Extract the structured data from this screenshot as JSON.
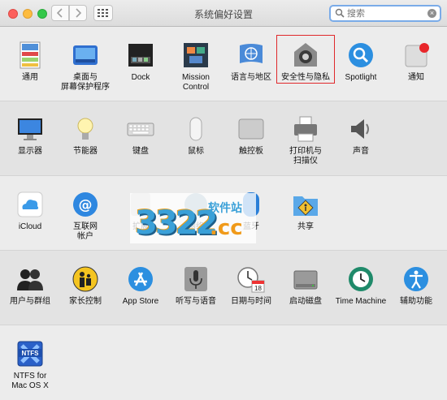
{
  "window": {
    "title": "系统偏好设置"
  },
  "search": {
    "placeholder": "搜索"
  },
  "watermark": {
    "digits": "3322",
    "domain": ".cc",
    "brand": "软件站"
  },
  "rows": [
    [
      {
        "label": "通用",
        "icon": "general-icon"
      },
      {
        "label": "桌面与\n屏幕保护程序",
        "icon": "desktop-screensaver-icon"
      },
      {
        "label": "Dock",
        "icon": "dock-icon"
      },
      {
        "label": "Mission\nControl",
        "icon": "mission-control-icon"
      },
      {
        "label": "语言与地区",
        "icon": "language-region-icon"
      },
      {
        "label": "安全性与隐私",
        "icon": "security-privacy-icon"
      },
      {
        "label": "Spotlight",
        "icon": "spotlight-icon"
      },
      {
        "label": "通知",
        "icon": "notifications-icon"
      }
    ],
    [
      {
        "label": "显示器",
        "icon": "displays-icon"
      },
      {
        "label": "节能器",
        "icon": "energy-saver-icon"
      },
      {
        "label": "键盘",
        "icon": "keyboard-icon"
      },
      {
        "label": "鼠标",
        "icon": "mouse-icon"
      },
      {
        "label": "触控板",
        "icon": "trackpad-icon"
      },
      {
        "label": "打印机与\n扫描仪",
        "icon": "printers-scanners-icon"
      },
      {
        "label": "声音",
        "icon": "sound-icon"
      }
    ],
    [
      {
        "label": "iCloud",
        "icon": "icloud-icon"
      },
      {
        "label": "互联网\n帐户",
        "icon": "internet-accounts-icon"
      },
      {
        "label": "扩展",
        "icon": "extensions-icon"
      },
      {
        "label": "网络",
        "icon": "network-icon"
      },
      {
        "label": "蓝牙",
        "icon": "bluetooth-icon"
      },
      {
        "label": "共享",
        "icon": "sharing-icon"
      }
    ],
    [
      {
        "label": "用户与群组",
        "icon": "users-groups-icon"
      },
      {
        "label": "家长控制",
        "icon": "parental-controls-icon"
      },
      {
        "label": "App Store",
        "icon": "app-store-icon"
      },
      {
        "label": "听写与语音",
        "icon": "dictation-speech-icon"
      },
      {
        "label": "日期与时间",
        "icon": "date-time-icon"
      },
      {
        "label": "启动磁盘",
        "icon": "startup-disk-icon"
      },
      {
        "label": "Time Machine",
        "icon": "time-machine-icon"
      },
      {
        "label": "辅助功能",
        "icon": "accessibility-icon"
      }
    ],
    [
      {
        "label": "NTFS for\nMac OS X",
        "icon": "ntfs-icon"
      }
    ]
  ],
  "ntfs_badge": "NTFS",
  "calendar_day": "18"
}
